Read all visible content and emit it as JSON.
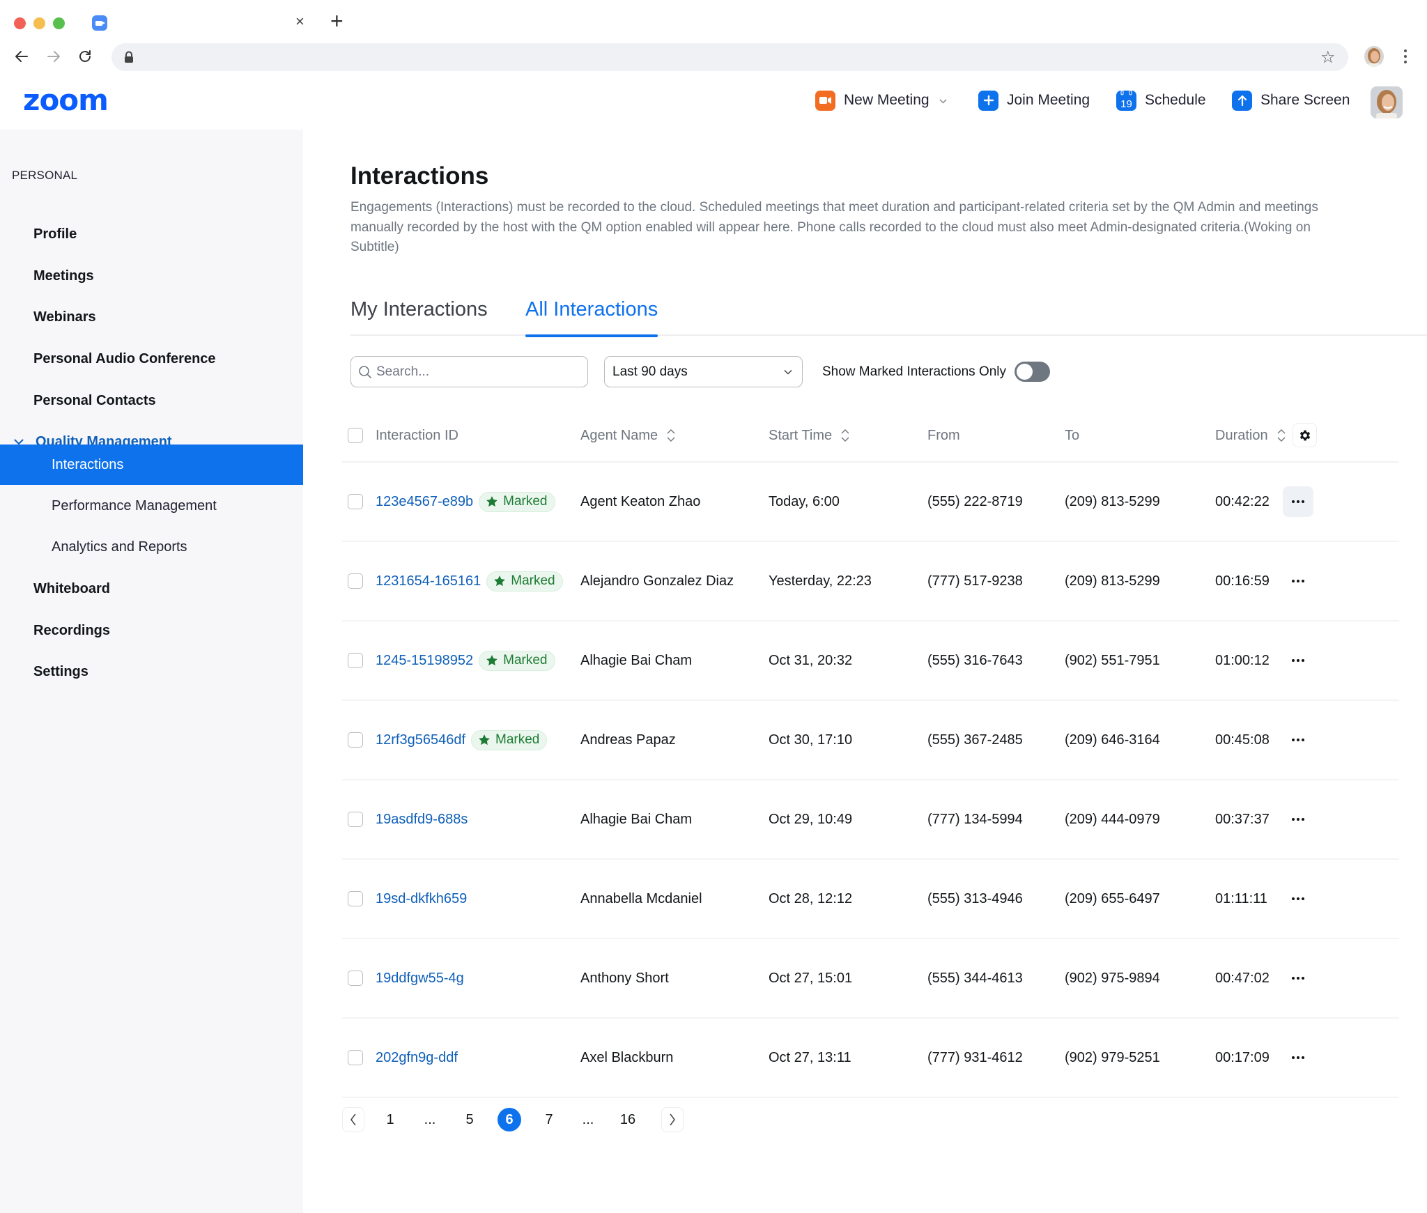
{
  "browser": {
    "tab_close": "×",
    "tab_new": "+",
    "favicon": "zoom-camera-icon",
    "icons": [
      "back-arrow-icon",
      "forward-arrow-icon",
      "reload-icon",
      "lock-icon",
      "star-icon",
      "profile-avatar",
      "kebab-menu-icon"
    ]
  },
  "header": {
    "logo": "zoom",
    "actions": [
      {
        "label": "New Meeting",
        "icon": "video-camera-icon",
        "color": "#f26d21",
        "has_dropdown": true
      },
      {
        "label": "Join Meeting",
        "icon": "plus-icon",
        "color": "#0e72ed"
      },
      {
        "label": "Schedule",
        "icon": "calendar-icon",
        "icon_text": "19",
        "color": "#0e72ed"
      },
      {
        "label": "Share Screen",
        "icon": "arrow-up-icon",
        "color": "#0e72ed"
      }
    ]
  },
  "sidebar": {
    "section_label": "PERSONAL",
    "items": [
      {
        "label": "Profile",
        "level": "top"
      },
      {
        "label": "Meetings",
        "level": "top"
      },
      {
        "label": "Webinars",
        "level": "top"
      },
      {
        "label": "Personal Audio Conference",
        "level": "top"
      },
      {
        "label": "Personal Contacts",
        "level": "top"
      },
      {
        "label": "Quality Management",
        "level": "group",
        "expanded": true
      },
      {
        "label": "Interactions",
        "level": "sub",
        "active": true
      },
      {
        "label": "Performance Management",
        "level": "sub"
      },
      {
        "label": "Analytics and Reports",
        "level": "sub"
      },
      {
        "label": "Whiteboard",
        "level": "top"
      },
      {
        "label": "Recordings",
        "level": "top"
      },
      {
        "label": "Settings",
        "level": "top"
      }
    ]
  },
  "main": {
    "title": "Interactions",
    "description": "Engagements (Interactions) must be recorded to the cloud. Scheduled meetings that meet duration and participant-related criteria set by the QM Admin and meetings manually recorded by the host with the QM option enabled will appear here. Phone calls recorded to the cloud must also meet Admin-designated criteria.(Woking on Subtitle)",
    "tabs": [
      {
        "label": "My Interactions",
        "active": false
      },
      {
        "label": "All Interactions",
        "active": true
      }
    ],
    "filters": {
      "search_placeholder": "Search...",
      "search_value": "",
      "date_range": "Last 90 days",
      "toggle_label": "Show Marked Interactions Only",
      "toggle_on": false
    },
    "table": {
      "columns": [
        "Interaction ID",
        "Agent Name",
        "Start Time",
        "From",
        "To",
        "Duration"
      ],
      "sortable": [
        false,
        true,
        true,
        false,
        false,
        true
      ],
      "marked_label": "Marked",
      "rows": [
        {
          "id": "123e4567-e89b",
          "marked": true,
          "agent": "Agent Keaton Zhao",
          "start": "Today, 6:00",
          "from": "(555) 222-8719",
          "to": "(209) 813-5299",
          "duration": "00:42:22"
        },
        {
          "id": "1231654-165161",
          "marked": true,
          "agent": "Alejandro Gonzalez Diaz",
          "start": "Yesterday, 22:23",
          "from": "(777) 517-9238",
          "to": "(209) 813-5299",
          "duration": "00:16:59"
        },
        {
          "id": "1245-15198952",
          "marked": true,
          "agent": "Alhagie Bai Cham",
          "start": "Oct 31, 20:32",
          "from": "(555) 316-7643",
          "to": "(902) 551-7951",
          "duration": "01:00:12"
        },
        {
          "id": "12rf3g56546df",
          "marked": true,
          "agent": "Andreas Papaz",
          "start": "Oct 30, 17:10",
          "from": "(555) 367-2485",
          "to": "(209) 646-3164",
          "duration": "00:45:08"
        },
        {
          "id": "19asdfd9-688s",
          "marked": false,
          "agent": "Alhagie Bai Cham",
          "start": "Oct 29, 10:49",
          "from": "(777) 134-5994",
          "to": "(209) 444-0979",
          "duration": "00:37:37"
        },
        {
          "id": "19sd-dkfkh659",
          "marked": false,
          "agent": "Annabella Mcdaniel",
          "start": "Oct 28, 12:12",
          "from": "(555) 313-4946",
          "to": "(209) 655-6497",
          "duration": "01:11:11"
        },
        {
          "id": "19ddfgw55-4g",
          "marked": false,
          "agent": "Anthony Short",
          "start": "Oct 27, 15:01",
          "from": "(555) 344-4613",
          "to": "(902) 975-9894",
          "duration": "00:47:02"
        },
        {
          "id": "202gfn9g-ddf",
          "marked": false,
          "agent": "Axel Blackburn",
          "start": "Oct 27, 13:11",
          "from": "(777) 931-4612",
          "to": "(902) 979-5251",
          "duration": "00:17:09"
        }
      ]
    },
    "pagination": {
      "pages": [
        "1",
        "...",
        "5",
        "6",
        "7",
        "...",
        "16"
      ],
      "current": "6",
      "total_pages": 16
    }
  },
  "colors": {
    "accent": "#0e72ed",
    "link": "#0e5fb9",
    "marked_green": "#1e7b34",
    "marked_bg": "#ebf7ee",
    "sidebar_bg": "#f7f7fa",
    "new_meeting_orange": "#f26d21",
    "logo_blue": "#0b5cff"
  }
}
